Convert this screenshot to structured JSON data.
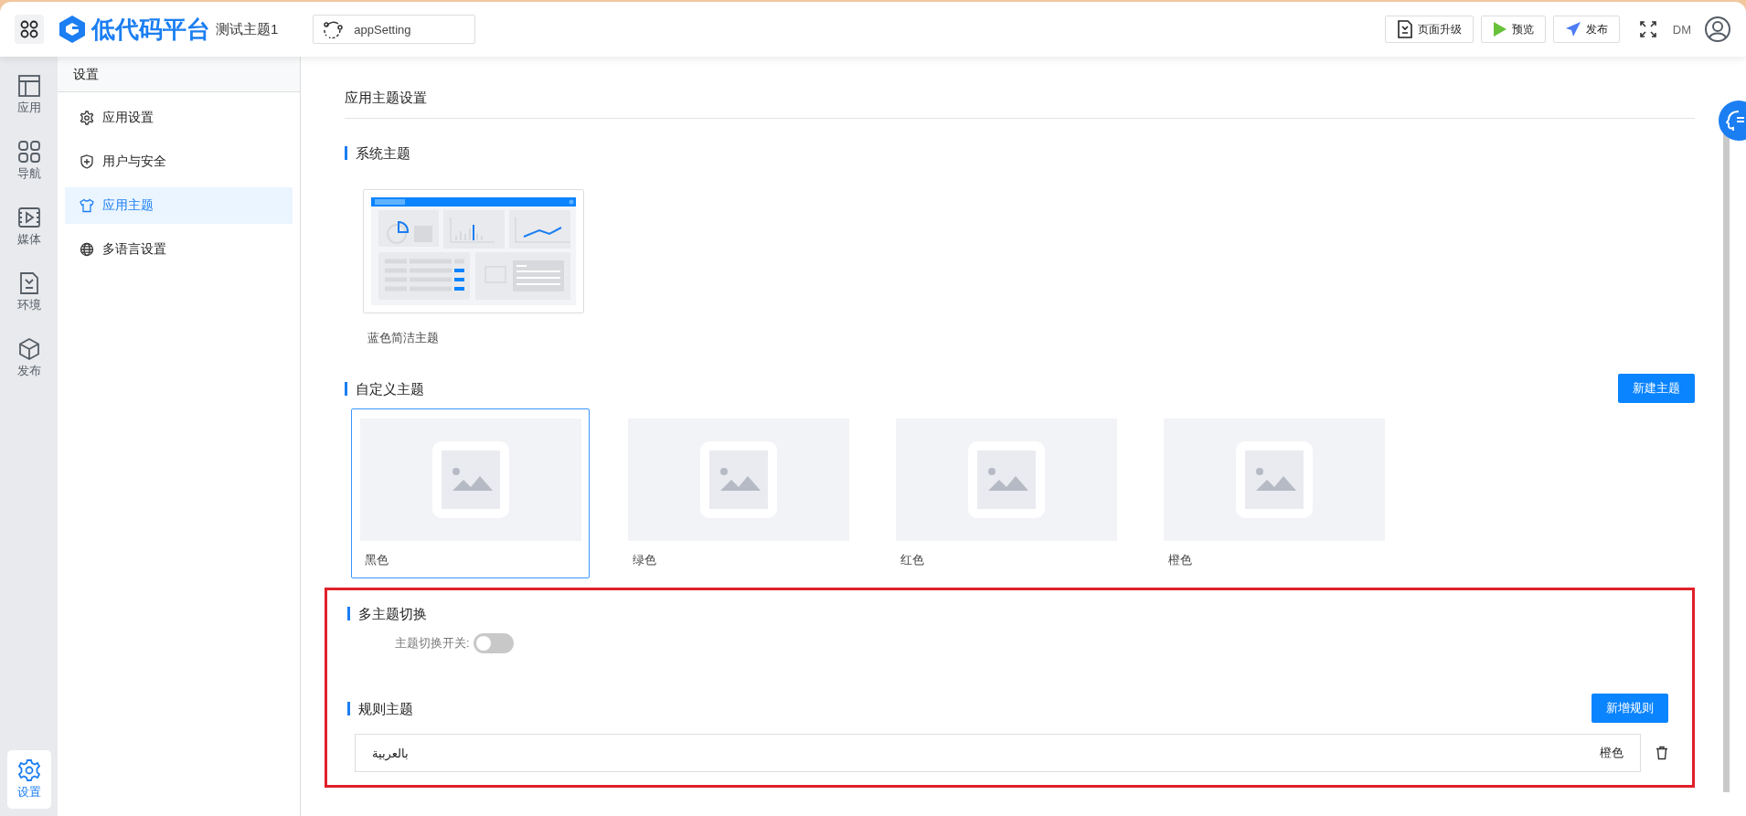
{
  "header": {
    "logo_text": "低代码平台",
    "project_name": "测试主题1",
    "page_selector": {
      "value": "appSetting"
    },
    "actions": [
      {
        "kind": "upgrade",
        "label": "页面升级"
      },
      {
        "kind": "preview",
        "label": "预览"
      },
      {
        "kind": "publish",
        "label": "发布"
      }
    ],
    "user_initials": "DM"
  },
  "rail": [
    {
      "kind": "app",
      "label": "应用",
      "selected": false
    },
    {
      "kind": "nav",
      "label": "导航",
      "selected": false
    },
    {
      "kind": "media",
      "label": "媒体",
      "selected": false
    },
    {
      "kind": "env",
      "label": "环境",
      "selected": false
    },
    {
      "kind": "publish",
      "label": "发布",
      "selected": false
    },
    {
      "kind": "settings",
      "label": "设置",
      "selected": true
    }
  ],
  "sidebar": {
    "title": "设置",
    "items": [
      {
        "kind": "gear",
        "label": "应用设置",
        "selected": false
      },
      {
        "kind": "shield",
        "label": "用户与安全",
        "selected": false
      },
      {
        "kind": "shirt",
        "label": "应用主题",
        "selected": true
      },
      {
        "kind": "globe",
        "label": "多语言设置",
        "selected": false
      }
    ]
  },
  "page_title": "应用主题设置",
  "system_themes": {
    "title": "系统主题",
    "cards": [
      {
        "label": "蓝色简洁主题"
      }
    ]
  },
  "custom_themes": {
    "title": "自定义主题",
    "button": "新建主题",
    "cards": [
      {
        "label": "黑色",
        "selected": true
      },
      {
        "label": "绿色",
        "selected": false
      },
      {
        "label": "红色",
        "selected": false
      },
      {
        "label": "橙色",
        "selected": false
      }
    ]
  },
  "multi_theme": {
    "title": "多主题切换",
    "switch_label": "主题切换开关:",
    "on": false
  },
  "rule_themes": {
    "title": "规则主题",
    "button": "新增规则",
    "rows": [
      {
        "condition": "بالعربية",
        "theme": "橙色"
      }
    ]
  }
}
